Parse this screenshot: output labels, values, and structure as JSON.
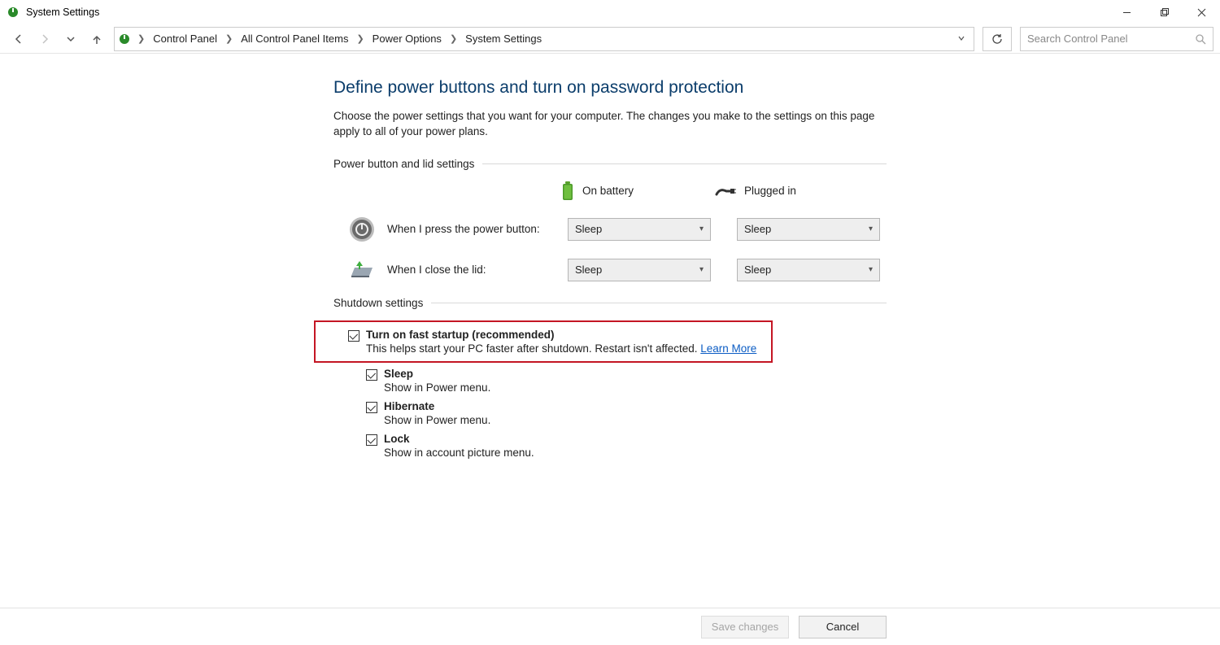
{
  "window": {
    "title": "System Settings"
  },
  "breadcrumb": {
    "items": [
      "Control Panel",
      "All Control Panel Items",
      "Power Options",
      "System Settings"
    ]
  },
  "search": {
    "placeholder": "Search Control Panel"
  },
  "page": {
    "title": "Define power buttons and turn on password protection",
    "description": "Choose the power settings that you want for your computer. The changes you make to the settings on this page apply to all of your power plans."
  },
  "sections": {
    "power_lid": {
      "header": "Power button and lid settings",
      "columns": {
        "battery": "On battery",
        "plugged": "Plugged in"
      },
      "rows": {
        "power_button": {
          "label": "When I press the power button:",
          "battery_value": "Sleep",
          "plugged_value": "Sleep"
        },
        "close_lid": {
          "label": "When I close the lid:",
          "battery_value": "Sleep",
          "plugged_value": "Sleep"
        }
      }
    },
    "shutdown": {
      "header": "Shutdown settings",
      "items": {
        "fast_startup": {
          "title": "Turn on fast startup (recommended)",
          "desc": "This helps start your PC faster after shutdown. Restart isn't affected. ",
          "link": "Learn More"
        },
        "sleep": {
          "title": "Sleep",
          "desc": "Show in Power menu."
        },
        "hibernate": {
          "title": "Hibernate",
          "desc": "Show in Power menu."
        },
        "lock": {
          "title": "Lock",
          "desc": "Show in account picture menu."
        }
      }
    }
  },
  "footer": {
    "save": "Save changes",
    "cancel": "Cancel"
  }
}
